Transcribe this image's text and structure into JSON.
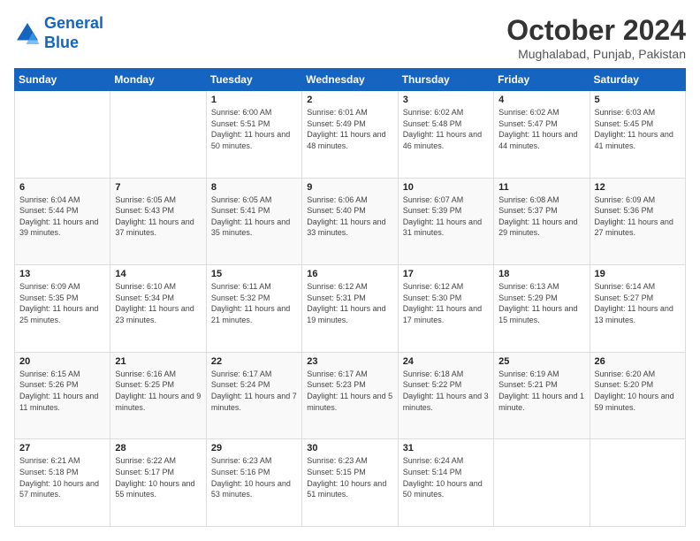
{
  "logo": {
    "line1": "General",
    "line2": "Blue"
  },
  "header": {
    "month": "October 2024",
    "location": "Mughalabad, Punjab, Pakistan"
  },
  "weekdays": [
    "Sunday",
    "Monday",
    "Tuesday",
    "Wednesday",
    "Thursday",
    "Friday",
    "Saturday"
  ],
  "weeks": [
    [
      {
        "day": "",
        "info": ""
      },
      {
        "day": "",
        "info": ""
      },
      {
        "day": "1",
        "info": "Sunrise: 6:00 AM\nSunset: 5:51 PM\nDaylight: 11 hours and 50 minutes."
      },
      {
        "day": "2",
        "info": "Sunrise: 6:01 AM\nSunset: 5:49 PM\nDaylight: 11 hours and 48 minutes."
      },
      {
        "day": "3",
        "info": "Sunrise: 6:02 AM\nSunset: 5:48 PM\nDaylight: 11 hours and 46 minutes."
      },
      {
        "day": "4",
        "info": "Sunrise: 6:02 AM\nSunset: 5:47 PM\nDaylight: 11 hours and 44 minutes."
      },
      {
        "day": "5",
        "info": "Sunrise: 6:03 AM\nSunset: 5:45 PM\nDaylight: 11 hours and 41 minutes."
      }
    ],
    [
      {
        "day": "6",
        "info": "Sunrise: 6:04 AM\nSunset: 5:44 PM\nDaylight: 11 hours and 39 minutes."
      },
      {
        "day": "7",
        "info": "Sunrise: 6:05 AM\nSunset: 5:43 PM\nDaylight: 11 hours and 37 minutes."
      },
      {
        "day": "8",
        "info": "Sunrise: 6:05 AM\nSunset: 5:41 PM\nDaylight: 11 hours and 35 minutes."
      },
      {
        "day": "9",
        "info": "Sunrise: 6:06 AM\nSunset: 5:40 PM\nDaylight: 11 hours and 33 minutes."
      },
      {
        "day": "10",
        "info": "Sunrise: 6:07 AM\nSunset: 5:39 PM\nDaylight: 11 hours and 31 minutes."
      },
      {
        "day": "11",
        "info": "Sunrise: 6:08 AM\nSunset: 5:37 PM\nDaylight: 11 hours and 29 minutes."
      },
      {
        "day": "12",
        "info": "Sunrise: 6:09 AM\nSunset: 5:36 PM\nDaylight: 11 hours and 27 minutes."
      }
    ],
    [
      {
        "day": "13",
        "info": "Sunrise: 6:09 AM\nSunset: 5:35 PM\nDaylight: 11 hours and 25 minutes."
      },
      {
        "day": "14",
        "info": "Sunrise: 6:10 AM\nSunset: 5:34 PM\nDaylight: 11 hours and 23 minutes."
      },
      {
        "day": "15",
        "info": "Sunrise: 6:11 AM\nSunset: 5:32 PM\nDaylight: 11 hours and 21 minutes."
      },
      {
        "day": "16",
        "info": "Sunrise: 6:12 AM\nSunset: 5:31 PM\nDaylight: 11 hours and 19 minutes."
      },
      {
        "day": "17",
        "info": "Sunrise: 6:12 AM\nSunset: 5:30 PM\nDaylight: 11 hours and 17 minutes."
      },
      {
        "day": "18",
        "info": "Sunrise: 6:13 AM\nSunset: 5:29 PM\nDaylight: 11 hours and 15 minutes."
      },
      {
        "day": "19",
        "info": "Sunrise: 6:14 AM\nSunset: 5:27 PM\nDaylight: 11 hours and 13 minutes."
      }
    ],
    [
      {
        "day": "20",
        "info": "Sunrise: 6:15 AM\nSunset: 5:26 PM\nDaylight: 11 hours and 11 minutes."
      },
      {
        "day": "21",
        "info": "Sunrise: 6:16 AM\nSunset: 5:25 PM\nDaylight: 11 hours and 9 minutes."
      },
      {
        "day": "22",
        "info": "Sunrise: 6:17 AM\nSunset: 5:24 PM\nDaylight: 11 hours and 7 minutes."
      },
      {
        "day": "23",
        "info": "Sunrise: 6:17 AM\nSunset: 5:23 PM\nDaylight: 11 hours and 5 minutes."
      },
      {
        "day": "24",
        "info": "Sunrise: 6:18 AM\nSunset: 5:22 PM\nDaylight: 11 hours and 3 minutes."
      },
      {
        "day": "25",
        "info": "Sunrise: 6:19 AM\nSunset: 5:21 PM\nDaylight: 11 hours and 1 minute."
      },
      {
        "day": "26",
        "info": "Sunrise: 6:20 AM\nSunset: 5:20 PM\nDaylight: 10 hours and 59 minutes."
      }
    ],
    [
      {
        "day": "27",
        "info": "Sunrise: 6:21 AM\nSunset: 5:18 PM\nDaylight: 10 hours and 57 minutes."
      },
      {
        "day": "28",
        "info": "Sunrise: 6:22 AM\nSunset: 5:17 PM\nDaylight: 10 hours and 55 minutes."
      },
      {
        "day": "29",
        "info": "Sunrise: 6:23 AM\nSunset: 5:16 PM\nDaylight: 10 hours and 53 minutes."
      },
      {
        "day": "30",
        "info": "Sunrise: 6:23 AM\nSunset: 5:15 PM\nDaylight: 10 hours and 51 minutes."
      },
      {
        "day": "31",
        "info": "Sunrise: 6:24 AM\nSunset: 5:14 PM\nDaylight: 10 hours and 50 minutes."
      },
      {
        "day": "",
        "info": ""
      },
      {
        "day": "",
        "info": ""
      }
    ]
  ]
}
